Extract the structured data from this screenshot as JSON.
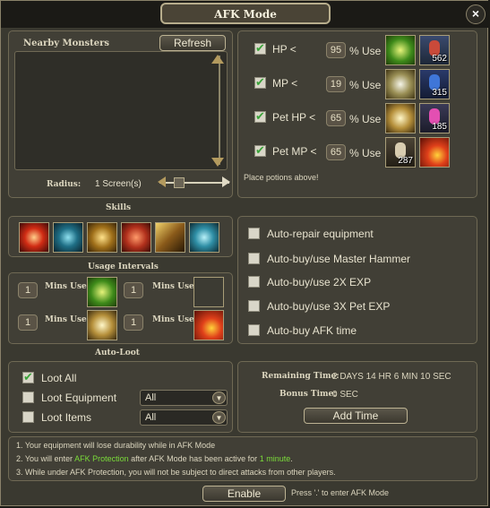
{
  "window": {
    "title": "AFK Mode",
    "close_glyph": "×"
  },
  "monsters": {
    "label": "Nearby Monsters",
    "refresh": "Refresh",
    "radius_label": "Radius:",
    "radius_value": "1 Screen(s)"
  },
  "potions": {
    "rows": [
      {
        "label": "HP <",
        "value": "95",
        "suffix": "% Use",
        "checked": true,
        "qty": "562"
      },
      {
        "label": "MP <",
        "value": "19",
        "suffix": "% Use",
        "checked": true,
        "qty": "315"
      },
      {
        "label": "Pet HP <",
        "value": "65",
        "suffix": "% Use",
        "checked": true,
        "qty": "185"
      },
      {
        "label": "Pet MP <",
        "value": "65",
        "suffix": "% Use",
        "checked": true,
        "qty": "287"
      }
    ],
    "note": "Place potions above!"
  },
  "skills": {
    "label": "Skills",
    "usage_label": "Usage Intervals",
    "mins_use": "Mins Use",
    "values": [
      "1",
      "1",
      "1",
      "1"
    ]
  },
  "autoloot": {
    "label": "Auto-Loot"
  },
  "options": [
    "Auto-repair equipment",
    "Auto-buy/use Master Hammer",
    "Auto-buy/use 2X EXP",
    "Auto-buy/use 3X Pet EXP",
    "Auto-buy AFK time"
  ],
  "loot": {
    "all": "Loot All",
    "equipment": "Loot Equipment",
    "items": "Loot Items",
    "equipment_select": "All",
    "items_select": "All"
  },
  "time": {
    "remaining_label": "Remaining Time:",
    "remaining_value": "2 DAYS 14 HR 6 MIN 10 SEC",
    "bonus_label": "Bonus Time:",
    "bonus_value": "0 SEC",
    "add": "Add Time"
  },
  "notes": {
    "line1": "1. Your equipment will lose durability while in AFK Mode",
    "line2a": "2. You will enter ",
    "line2b": "AFK Protection",
    "line2c": " after AFK Mode has been active for ",
    "line2d": "1 minute",
    "line2e": ".",
    "line3": "3. While under AFK Protection, you will not be subject to direct attacks from other players."
  },
  "footer": {
    "enable": "Enable",
    "hint": "Press '.' to enter AFK Mode"
  },
  "colors": {
    "accent_green": "#7bdc3a",
    "panel": "#413f36",
    "border": "#6f6954"
  }
}
